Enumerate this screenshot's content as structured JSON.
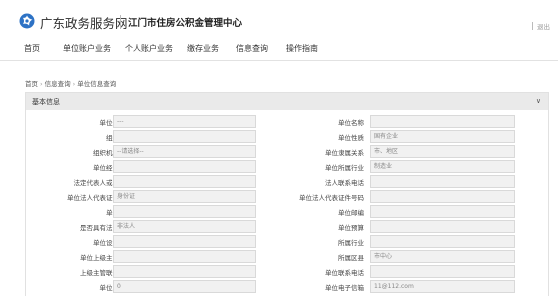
{
  "header": {
    "brand": "广东政务服务网",
    "center_name": "江门市住房公积金管理中心",
    "exit": "退出"
  },
  "nav": [
    "首页",
    "单位账户业务",
    "个人账户业务",
    "缴存业务",
    "信息查询",
    "操作指南"
  ],
  "breadcrumb": [
    "首页",
    "信息查询",
    "单位信息查询"
  ],
  "panel": {
    "title": "基本信息",
    "collapse": "∨"
  },
  "form": {
    "rows": [
      {
        "l": {
          "label": "单位登记号",
          "value": "---"
        },
        "r": {
          "label": "单位名称",
          "value": ""
        }
      },
      {
        "l": {
          "label": "组织机构",
          "value": ""
        },
        "r": {
          "label": "单位性质",
          "value": "国有企业"
        }
      },
      {
        "l": {
          "label": "组织机构类型",
          "value": "--请选择--"
        },
        "r": {
          "label": "单位隶属关系",
          "value": "市、地区"
        }
      },
      {
        "l": {
          "label": "单位经济类型",
          "value": ""
        },
        "r": {
          "label": "单位所属行业",
          "value": "制造业"
        }
      },
      {
        "l": {
          "label": "法定代表人或负责人",
          "value": ""
        },
        "r": {
          "label": "法人联系电话",
          "value": ""
        }
      },
      {
        "l": {
          "label": "单位法人代表证件类型",
          "value": "身份证"
        },
        "r": {
          "label": "单位法人代表证件号码",
          "value": ""
        }
      },
      {
        "l": {
          "label": "单位地址",
          "value": ""
        },
        "r": {
          "label": "单位邮编",
          "value": ""
        }
      },
      {
        "l": {
          "label": "是否具有法人资格",
          "value": "非法人"
        },
        "r": {
          "label": "单位预算",
          "value": ""
        }
      },
      {
        "l": {
          "label": "单位设立日期",
          "value": ""
        },
        "r": {
          "label": "所属行业",
          "value": ""
        }
      },
      {
        "l": {
          "label": "单位上级主管部门",
          "value": ""
        },
        "r": {
          "label": "所属区县",
          "value": "市中心"
        }
      },
      {
        "l": {
          "label": "上级主管联系电话",
          "value": ""
        },
        "r": {
          "label": "单位联系电话",
          "value": ""
        }
      },
      {
        "l": {
          "label": "单位发薪日",
          "value": "0"
        },
        "r": {
          "label": "单位电子信箱",
          "value": "11@112.com"
        }
      }
    ]
  },
  "colors": {
    "logo": "#2d72c5",
    "panel_head": "#eaeaea",
    "field_bg": "#f1f1f1"
  }
}
